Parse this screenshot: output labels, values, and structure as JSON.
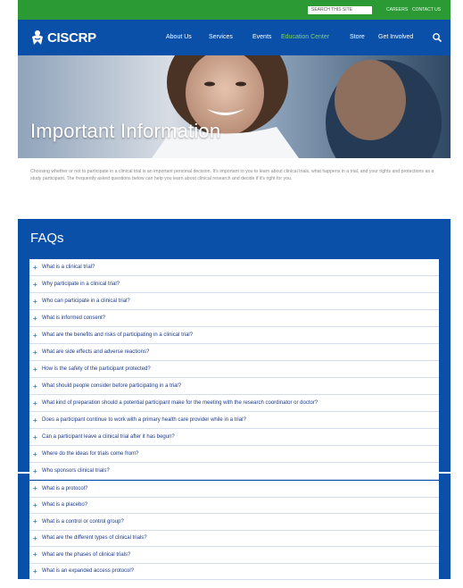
{
  "topbar": {
    "search_placeholder": "SEARCH THIS SITE",
    "links": [
      "CAREERS",
      "CONTACT US"
    ]
  },
  "logo": {
    "text": "CISCRP"
  },
  "nav": {
    "items": [
      "About Us",
      "Services",
      "Events",
      "Education Center",
      "Store",
      "Get Involved"
    ],
    "active_index": 3
  },
  "hero": {
    "title": "Important Information"
  },
  "intro": {
    "text": "Choosing whether or not to participate in a clinical trial is an important personal decision. It's important to you to learn about clinical trials, what happens in a trial, and your rights and protections as a study participant. The frequently asked questions below can help you learn about clinical research and decide if it's right for you."
  },
  "faq": {
    "title": "FAQs",
    "items": [
      "What is a clinical trial?",
      "Why participate in a clinical trial?",
      "Who can participate in a clinical trial?",
      "What is informed consent?",
      "What are the benefits and risks of participating in a clinical trial?",
      "What are side effects and adverse reactions?",
      "How is the safety of the participant protected?",
      "What should people consider before participating in a trial?",
      "What kind of preparation should a potential participant make for the meeting with the research coordinator or doctor?",
      "Does a participant continue to work with a primary health care provider while in a trial?",
      "Can a participant leave a clinical trial after it has begun?",
      "Where do the ideas for trials come from?",
      "Who sponsors clinical trials?"
    ],
    "items2": [
      "What is a protocol?",
      "What is a placebo?",
      "What is a control or control group?",
      "What are the different types of clinical trials?",
      "What are the phases of clinical trials?",
      "What is an expanded access protocol?"
    ]
  },
  "colors": {
    "brand_blue": "#0a4fa8",
    "brand_green": "#2b9a34",
    "accent_green": "#7fd36a"
  }
}
